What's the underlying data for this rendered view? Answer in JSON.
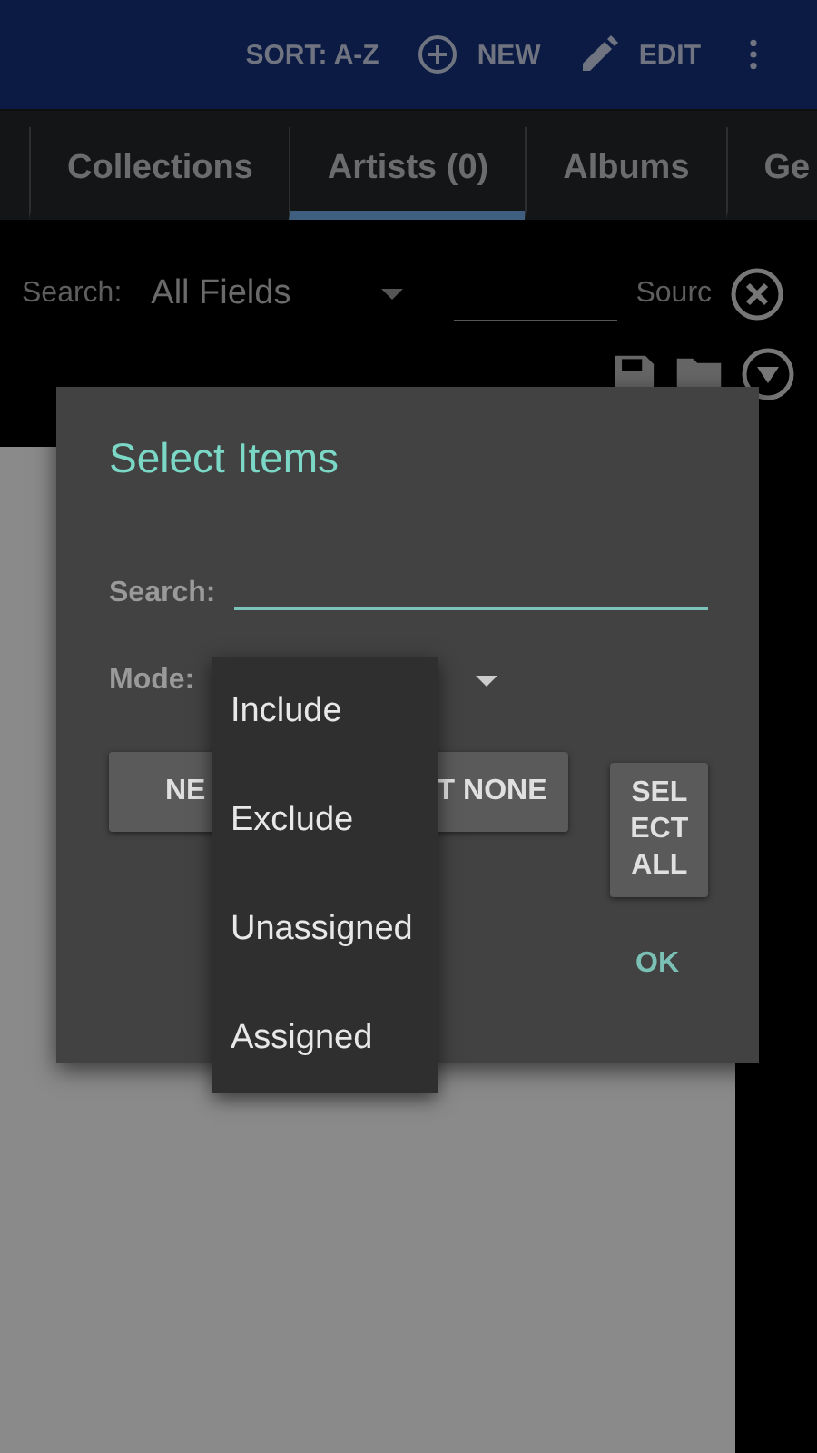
{
  "app_bar": {
    "actions": [
      {
        "kind": "text",
        "label": "SORT: A-Z"
      },
      {
        "kind": "new",
        "label": "NEW"
      },
      {
        "kind": "edit",
        "label": "EDIT"
      },
      {
        "kind": "more"
      }
    ]
  },
  "tabs": [
    {
      "label": "Collections",
      "selected": false
    },
    {
      "label": "Artists (0)",
      "selected": true
    },
    {
      "label": "Albums",
      "selected": false
    },
    {
      "label": "Ge",
      "selected": false
    }
  ],
  "search_bar": {
    "label": "Search:",
    "field": "All Fields",
    "source": "Sourc"
  },
  "dialog": {
    "title": "Select Items",
    "search_label": "Search:",
    "mode_label": "Mode:",
    "buttons": [
      "NE",
      "T NONE"
    ],
    "select_all": "SEL ECT ALL",
    "ok": "OK"
  },
  "mode_menu": {
    "options": [
      "Include",
      "Exclude",
      "Unassigned",
      "Assigned"
    ]
  }
}
